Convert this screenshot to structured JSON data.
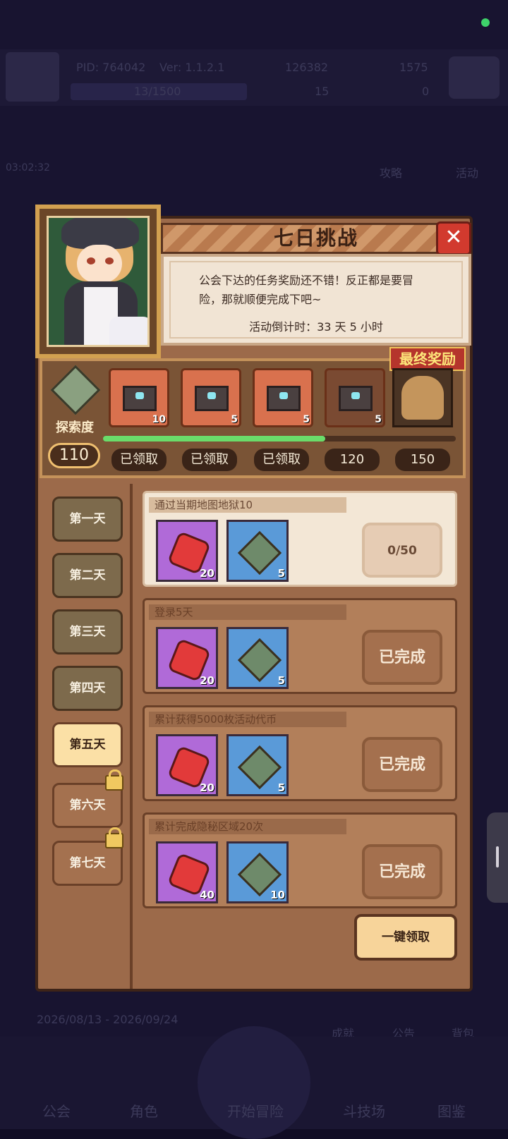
{
  "background": {
    "pid": "PID: 764042",
    "version": "Ver: 1.1.2.1",
    "currency_a": "126382",
    "currency_b": "1575",
    "energy": "13/1500",
    "stat_c": "15",
    "stat_d": "0",
    "timer": "03:02:32",
    "btn_guide": "攻略",
    "btn_event": "活动",
    "date_range": "2026/08/13 - 2026/09/24",
    "btn_achievement": "成就",
    "btn_notice": "公告",
    "btn_bag": "背包",
    "nav": [
      "公会",
      "角色",
      "开始冒险",
      "斗技场",
      "图鉴"
    ]
  },
  "panel": {
    "title": "七日挑战",
    "close": "✕",
    "description": "公会下达的任务奖励还不错！反正都是要冒险，那就顺便完成下吧~",
    "countdown": "活动倒计时：33 天 5 小时"
  },
  "progress": {
    "label": "探索度",
    "value": "110",
    "final_reward_label": "最终奖励",
    "fill_fraction": 0.63,
    "chests": [
      {
        "count": "10",
        "status": "已领取",
        "claimed": true
      },
      {
        "count": "5",
        "status": "已领取",
        "claimed": true
      },
      {
        "count": "5",
        "status": "已领取",
        "claimed": true
      },
      {
        "count": "5",
        "status": "120",
        "claimed": false
      }
    ],
    "final_milestone": "150"
  },
  "days": [
    {
      "label": "第一天",
      "state": "normal"
    },
    {
      "label": "第二天",
      "state": "normal"
    },
    {
      "label": "第三天",
      "state": "normal"
    },
    {
      "label": "第四天",
      "state": "normal"
    },
    {
      "label": "第五天",
      "state": "active"
    },
    {
      "label": "第六天",
      "state": "locked"
    },
    {
      "label": "第七天",
      "state": "locked"
    }
  ],
  "tasks": [
    {
      "title": "通过当期地图地狱10",
      "gem": "20",
      "cross": "5",
      "status": "0/50",
      "done": false
    },
    {
      "title": "登录5天",
      "gem": "20",
      "cross": "5",
      "status": "已完成",
      "done": true
    },
    {
      "title": "累计获得5000枚活动代币",
      "gem": "20",
      "cross": "5",
      "status": "已完成",
      "done": true
    },
    {
      "title": "累计完成隐秘区域20次",
      "gem": "40",
      "cross": "10",
      "status": "已完成",
      "done": true
    }
  ],
  "claim_all": "一键领取"
}
